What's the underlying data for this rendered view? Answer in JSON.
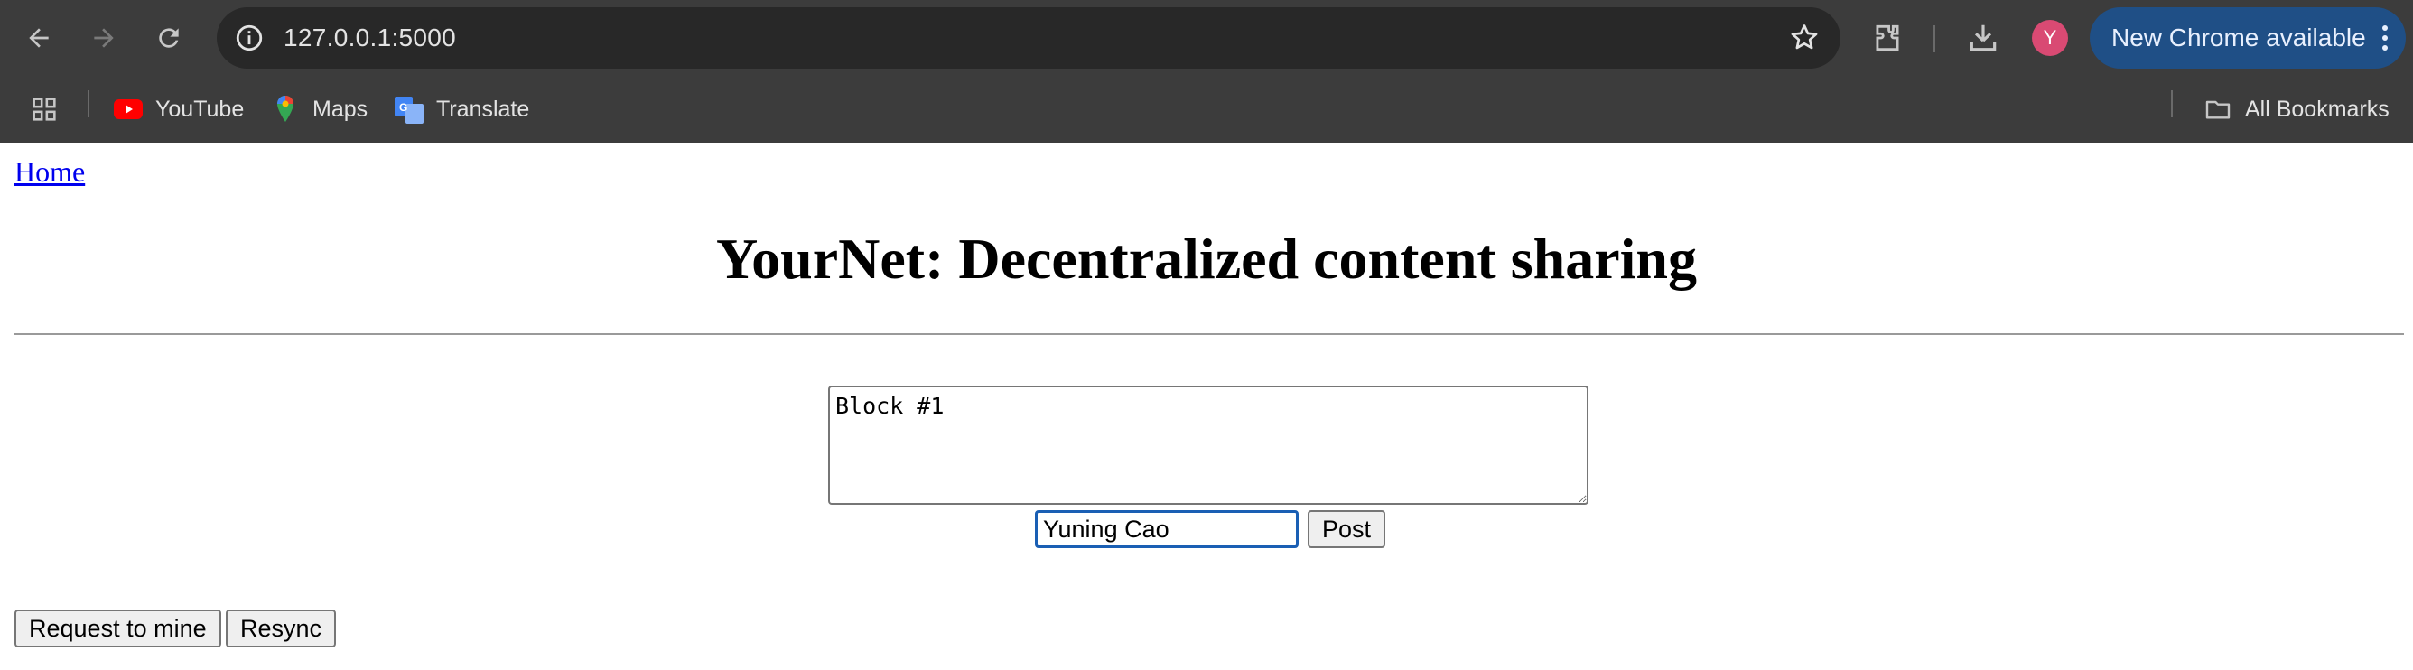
{
  "browser": {
    "url": "127.0.0.1:5000",
    "profile_initial": "Y",
    "update_label": "New Chrome available",
    "bookmarks": [
      {
        "label": "YouTube",
        "icon": "youtube-icon"
      },
      {
        "label": "Maps",
        "icon": "maps-icon"
      },
      {
        "label": "Translate",
        "icon": "translate-icon"
      }
    ],
    "all_bookmarks_label": "All Bookmarks",
    "colors": {
      "chrome_bg": "#3c3c3c",
      "omnibox_bg": "#282828",
      "update_pill": "#1f4f86",
      "avatar": "#d94a73"
    }
  },
  "page": {
    "home_link": "Home",
    "title": "YourNet: Decentralized content sharing",
    "form": {
      "content_value": "Block #1",
      "author_value": "Yuning Cao",
      "post_label": "Post"
    },
    "actions": {
      "mine_label": "Request to mine",
      "resync_label": "Resync"
    }
  }
}
